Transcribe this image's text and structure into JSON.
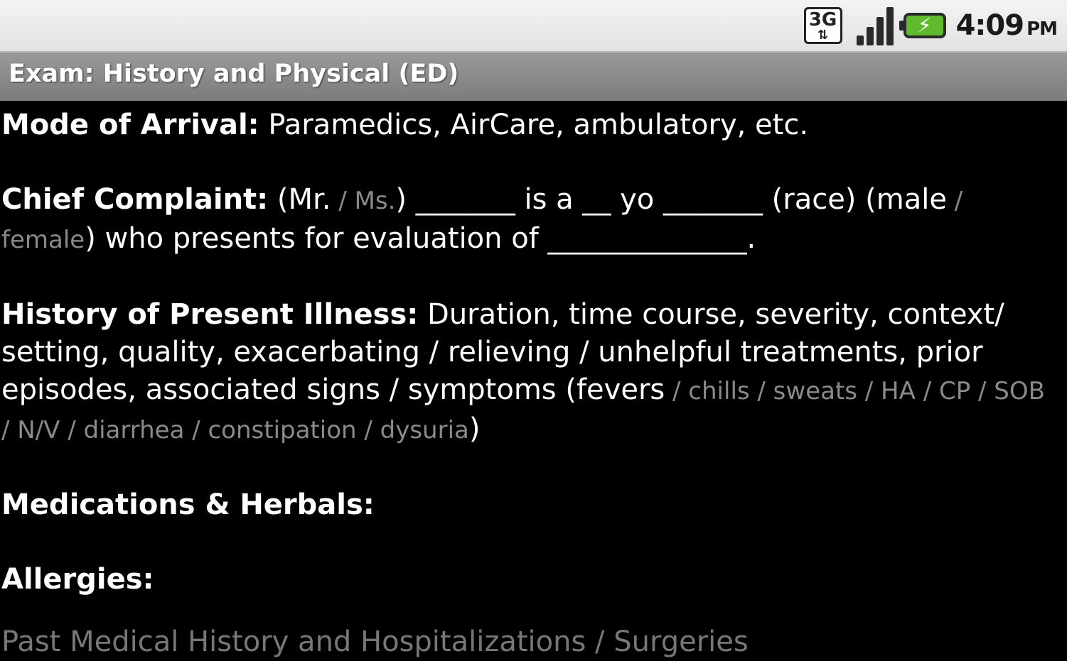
{
  "status_bar": {
    "network_label": "3G",
    "time": "4:09",
    "ampm": "PM",
    "signal_level": 1.0,
    "battery_level": 1.0,
    "battery_charging": true,
    "colors": {
      "battery": "#5fba2e"
    }
  },
  "title_bar": {
    "title": "Exam: History and Physical (ED)"
  },
  "sections": {
    "mode_of_arrival": {
      "label": "Mode of Arrival:",
      "text": " Paramedics, AirCare, ambulatory, etc."
    },
    "chief_complaint": {
      "label": "Chief Complaint:",
      "t1": " (Mr.",
      "g1": " / Ms.",
      "t2": ") _______ is a __ yo _______ (race) (male",
      "g2": " / female",
      "t3": ") who presents for evaluation of ______________."
    },
    "hpi": {
      "label": "History of Present Illness:",
      "text": " Duration, time course, severity, context/ setting, quality, exacerbating / relieving / unhelpful treatments, prior episodes, associated signs / symptoms (fevers",
      "gray": " / chills / sweats / HA / CP / SOB / N/V / diarrhea / constipation / dysuria",
      "close": ")"
    },
    "medications": {
      "label": "Medications & Herbals:"
    },
    "allergies": {
      "label": "Allergies:"
    }
  },
  "partial_line": "Past Medical History and Hospitalizations / Surgeries"
}
